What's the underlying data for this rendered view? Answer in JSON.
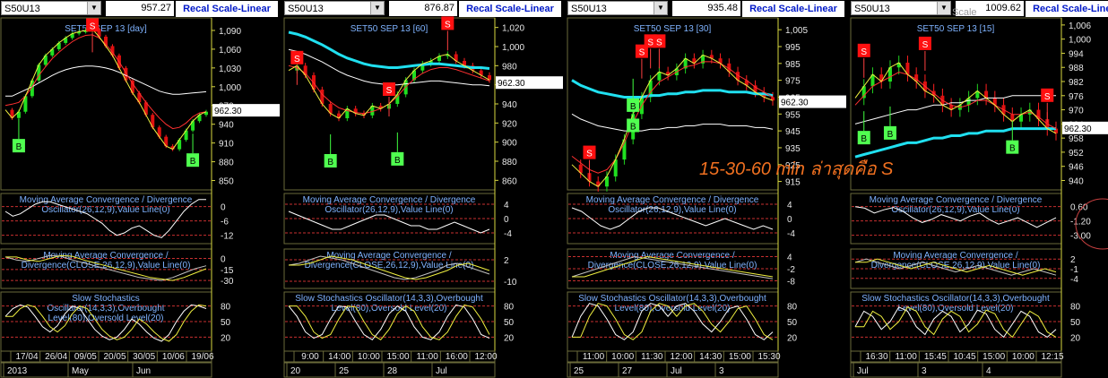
{
  "annotation": "15-30-60 min ล่าสุดคือ S",
  "scale_label": "Scale",
  "chart_data": [
    {
      "type": "line",
      "symbol": "S50U13",
      "last_price": "957.27",
      "button": "Recal Scale-Linear",
      "title": "SET50 SEP 13   [day]",
      "current": "962.30",
      "current_value": 962.3,
      "ylim": [
        835,
        1110
      ],
      "price_ticks": [
        1090,
        1060,
        1030,
        1000,
        970,
        940,
        910,
        880,
        850
      ],
      "price_tick_labels": [
        "1,090",
        "1,060",
        "1,030",
        "1,000",
        "970",
        "940",
        "910",
        "880",
        "850"
      ],
      "price": [
        963,
        950,
        960,
        985,
        1010,
        1035,
        1050,
        1060,
        1070,
        1078,
        1085,
        1088,
        1090,
        1092,
        1080,
        1065,
        1050,
        1030,
        1010,
        990,
        975,
        955,
        935,
        920,
        905,
        900,
        915,
        930,
        945,
        955,
        960
      ],
      "ma_slow": [
        985,
        985,
        990,
        995,
        1000,
        1006,
        1012,
        1018,
        1023,
        1027,
        1030,
        1032,
        1033,
        1033,
        1032,
        1030,
        1027,
        1023,
        1018,
        1013,
        1008,
        1003,
        998,
        993,
        990,
        988,
        988,
        989,
        990,
        991,
        992
      ],
      "ma_fast": [
        970,
        972,
        975,
        985,
        1000,
        1018,
        1032,
        1045,
        1055,
        1064,
        1072,
        1078,
        1082,
        1083,
        1078,
        1068,
        1055,
        1040,
        1022,
        1005,
        990,
        975,
        962,
        950,
        940,
        933,
        935,
        942,
        952,
        958,
        960
      ],
      "signals": [
        {
          "label": "B",
          "index": 2,
          "value": 905
        },
        {
          "label": "S",
          "index": 13,
          "value": 1098
        },
        {
          "label": "B",
          "index": 28,
          "value": 882
        }
      ],
      "macd1": {
        "title": "Moving Average Convergence / Divergence Oscillator(26,12,9),Value Line(0)",
        "ticks": [
          "0",
          "-6",
          "-12"
        ],
        "tick_values": [
          0,
          -6,
          -12
        ],
        "ylim": [
          -14,
          4
        ],
        "values": [
          -2,
          -4,
          -3,
          -1,
          1,
          2,
          2,
          1,
          0,
          -1,
          -2,
          -3,
          -5,
          -7,
          -10,
          -12,
          -11,
          -9,
          -8,
          -10,
          -12,
          -13,
          -10,
          -6,
          -2,
          1,
          3,
          3
        ]
      },
      "macd2": {
        "title": "Moving Average Convergence / Divergence(CLOSE,26,12,9),Value Line(0)",
        "ticks": [
          "0",
          "-15",
          "-30"
        ],
        "tick_values": [
          0,
          -15,
          -30
        ],
        "ylim": [
          -36,
          8
        ],
        "values": [
          2,
          -2,
          -4,
          0,
          4,
          3,
          -2,
          -6,
          -10,
          -14,
          -18,
          -22,
          -26,
          -28,
          -30,
          -26,
          -20,
          -14,
          -10
        ]
      },
      "stoch": {
        "title": "Slow Stochastics Oscillator(14,3,3),Overbought Level(80),Oversold Level(20)",
        "ticks": [
          "80",
          "50",
          "20"
        ],
        "tick_values": [
          80,
          50,
          20
        ],
        "values": [
          60,
          75,
          82,
          78,
          60,
          40,
          30,
          42,
          65,
          80,
          75,
          55,
          35,
          22,
          15,
          20,
          35,
          55,
          45,
          30,
          18,
          12,
          25,
          50,
          70,
          82,
          80,
          75
        ]
      },
      "time_labels": [
        "17/04",
        "26/04",
        "09/05",
        "20/05",
        "30/05",
        "10/06",
        "19/06"
      ],
      "period_labels": [
        "2013",
        "May",
        "Jun"
      ]
    },
    {
      "type": "line",
      "symbol": "S50U13",
      "last_price": "876.87",
      "button": "Recal Scale-Linear",
      "title": "SET50 SEP 13   [60]",
      "current": "962.30",
      "current_value": 962.3,
      "ylim": [
        850,
        1030
      ],
      "price_ticks": [
        1020,
        1000,
        980,
        960,
        940,
        920,
        900,
        880,
        860
      ],
      "price_tick_labels": [
        "1,020",
        "1,000",
        "980",
        "960",
        "940",
        "920",
        "900",
        "880",
        "860"
      ],
      "price": [
        975,
        980,
        970,
        955,
        940,
        930,
        925,
        935,
        930,
        928,
        938,
        935,
        940,
        950,
        965,
        975,
        982,
        985,
        990,
        992,
        985,
        980,
        975,
        970,
        965
      ],
      "ma_slow": [
        1015,
        1013,
        1010,
        1006,
        1002,
        997,
        992,
        988,
        985,
        982,
        980,
        979,
        978,
        978,
        979,
        980,
        981,
        982,
        982,
        981,
        980,
        979,
        978,
        978,
        977
      ],
      "ma_fast": [
        980,
        978,
        972,
        962,
        950,
        942,
        936,
        933,
        931,
        930,
        932,
        935,
        940,
        948,
        958,
        966,
        972,
        976,
        978,
        978,
        976,
        973,
        970,
        967,
        964
      ],
      "signals": [
        {
          "label": "S",
          "index": 1,
          "value": 988
        },
        {
          "label": "B",
          "index": 5,
          "value": 880
        },
        {
          "label": "S",
          "index": 12,
          "value": 955
        },
        {
          "label": "B",
          "index": 13,
          "value": 882
        },
        {
          "label": "S",
          "index": 19,
          "value": 1024
        }
      ],
      "macd1": {
        "title": "Moving Average Convergence / Divergence Oscillator(26,12,9),Value Line(0)",
        "ticks": [
          "4",
          "0",
          "-4"
        ],
        "tick_values": [
          4,
          0,
          -4
        ],
        "ylim": [
          -6,
          6
        ],
        "values": [
          2,
          1,
          0,
          -1,
          -2,
          -3,
          -3,
          -2,
          -1,
          0,
          1,
          1,
          0,
          -1,
          -2,
          -2,
          -3,
          -3,
          -2,
          -1,
          -2,
          -3,
          -4,
          -3
        ]
      },
      "macd2": {
        "title": "Moving Average Convergence / Divergence(CLOSE,26,12,9),Value Line(0)",
        "ticks": [
          "2",
          "-10"
        ],
        "tick_values": [
          2,
          -10
        ],
        "ylim": [
          -12,
          6
        ],
        "values": [
          -1,
          0,
          2,
          4,
          3,
          2,
          0,
          -2,
          -4,
          -6,
          -8,
          -9,
          -8,
          -6,
          -4,
          -1,
          0,
          -2,
          -4,
          -6
        ]
      },
      "stoch": {
        "title": "Slow Stochastics Oscillator(14,3,3),Overbought Level(80),Oversold Level(20)",
        "ticks": [
          "80",
          "50",
          "20"
        ],
        "tick_values": [
          80,
          50,
          20
        ],
        "values": [
          80,
          60,
          30,
          18,
          25,
          55,
          80,
          78,
          50,
          25,
          15,
          35,
          65,
          80,
          70,
          40,
          20,
          15,
          30,
          60,
          82,
          78,
          55,
          25,
          18
        ]
      },
      "time_labels": [
        "9:00",
        "14:00",
        "10:00",
        "15:00",
        "11:00",
        "16:00",
        "12:00"
      ],
      "period_labels": [
        "20",
        "25",
        "28",
        "Jul"
      ]
    },
    {
      "type": "line",
      "symbol": "S50U13",
      "last_price": "935.48",
      "button": "Recal Scale-Linear",
      "title": "SET50 SEP 13   [30]",
      "current": "962.30",
      "current_value": 962.3,
      "ylim": [
        910,
        1012
      ],
      "price_ticks": [
        1005,
        995,
        985,
        975,
        965,
        955,
        945,
        935,
        925,
        915
      ],
      "price_tick_labels": [
        "1,005",
        "995",
        "985",
        "975",
        "965",
        "955",
        "945",
        "935",
        "925",
        "915"
      ],
      "price": [
        925,
        920,
        915,
        912,
        918,
        928,
        940,
        955,
        965,
        975,
        980,
        978,
        982,
        988,
        985,
        990,
        988,
        985,
        980,
        975,
        972,
        968,
        965,
        963
      ],
      "ma_slow": [
        975,
        972,
        970,
        968,
        967,
        966,
        965,
        965,
        965,
        966,
        966,
        967,
        967,
        968,
        968,
        969,
        969,
        969,
        968,
        968,
        968,
        967,
        967,
        966
      ],
      "ma_fast": [
        930,
        926,
        922,
        920,
        922,
        928,
        938,
        950,
        960,
        968,
        974,
        977,
        980,
        983,
        984,
        986,
        986,
        985,
        982,
        978,
        975,
        971,
        968,
        965
      ],
      "signals": [
        {
          "label": "S",
          "index": 2,
          "value": 932
        },
        {
          "label": "B",
          "index": 7,
          "value": 948
        },
        {
          "label": "B",
          "index": 7,
          "value": 960
        },
        {
          "label": "S",
          "index": 8,
          "value": 992
        },
        {
          "label": "S",
          "index": 9,
          "value": 998
        },
        {
          "label": "S",
          "index": 10,
          "value": 998
        }
      ],
      "macd1": {
        "title": "Moving Average Convergence / Divergence Oscillator(26,12,9),Value Line(0)",
        "ticks": [
          "4",
          "0",
          "-4"
        ],
        "tick_values": [
          4,
          0,
          -4
        ],
        "ylim": [
          -6,
          6
        ],
        "values": [
          3,
          2,
          0,
          -2,
          -3,
          -2,
          0,
          2,
          3,
          3,
          2,
          1,
          0,
          -1,
          -2,
          -1,
          0,
          -1,
          -2,
          -3,
          -2,
          -3
        ]
      },
      "macd2": {
        "title": "Moving Average Convergence / Divergence(CLOSE,26,12,9),Value Line(0)",
        "ticks": [
          "4",
          "-2",
          "-8"
        ],
        "tick_values": [
          4,
          -2,
          -8
        ],
        "ylim": [
          -10,
          6
        ],
        "values": [
          -6,
          -4,
          -2,
          0,
          2,
          4,
          3,
          2,
          1,
          0,
          -1,
          -2,
          -3,
          -4,
          -5,
          -6,
          -7
        ]
      },
      "stoch": {
        "title": "Slow Stochastics Oscillator(14,3,3),Overbought Level(80),Oversold Level(20)",
        "ticks": [
          "80",
          "50",
          "20"
        ],
        "tick_values": [
          80,
          50,
          20
        ],
        "values": [
          20,
          60,
          85,
          80,
          55,
          25,
          15,
          30,
          70,
          85,
          80,
          60,
          80,
          85,
          70,
          45,
          30,
          50,
          75,
          80,
          55,
          25,
          15,
          30
        ]
      },
      "time_labels": [
        "11:00",
        "10:00",
        "11:30",
        "12:00",
        "14:30",
        "15:00",
        "15:30"
      ],
      "period_labels": [
        "25",
        "27",
        "Jul",
        "3"
      ]
    },
    {
      "type": "line",
      "symbol": "S50U13",
      "last_price": "1009.62",
      "button": "Recal Scale-Linear",
      "title": "SET50 SEP 13   [15]",
      "current": "962.30",
      "current_value": 962.3,
      "ylim": [
        936,
        1009
      ],
      "price_ticks": [
        1006,
        1000,
        994,
        988,
        982,
        976,
        970,
        964,
        958,
        952,
        946,
        940
      ],
      "price_tick_labels": [
        "1,006",
        "1,000",
        "994",
        "988",
        "982",
        "976",
        "970",
        "964",
        "958",
        "952",
        "946",
        "940"
      ],
      "price": [
        975,
        980,
        985,
        982,
        988,
        990,
        985,
        982,
        978,
        976,
        972,
        970,
        972,
        975,
        978,
        975,
        972,
        968,
        965,
        968,
        970,
        966,
        962,
        960
      ],
      "ma_slow": [
        950,
        951,
        952,
        953,
        954,
        955,
        956,
        956,
        957,
        958,
        958,
        959,
        959,
        960,
        960,
        961,
        961,
        961,
        962,
        962,
        962,
        962,
        962,
        962
      ],
      "ma_fast": [
        972,
        976,
        980,
        982,
        984,
        986,
        985,
        983,
        980,
        977,
        974,
        972,
        971,
        972,
        974,
        974,
        972,
        970,
        968,
        968,
        969,
        967,
        964,
        962
      ],
      "signals": [
        {
          "label": "B",
          "index": 1,
          "value": 958
        },
        {
          "label": "S",
          "index": 1,
          "value": 995
        },
        {
          "label": "B",
          "index": 4,
          "value": 960
        },
        {
          "label": "S",
          "index": 8,
          "value": 998
        },
        {
          "label": "B",
          "index": 18,
          "value": 954
        },
        {
          "label": "S",
          "index": 22,
          "value": 976
        }
      ],
      "macd1": {
        "title": "Moving Average Convergence / Divergence Oscillator(26,12,9),Value Line(0)",
        "ticks": [
          "0.60",
          "-1.20",
          "-3.00"
        ],
        "tick_values": [
          0.6,
          -1.2,
          -3.0
        ],
        "ylim": [
          -3.6,
          1.8
        ],
        "values": [
          0.6,
          0.4,
          -0.2,
          0.2,
          0.5,
          0.0,
          -0.8,
          -1.4,
          -1.0,
          -0.4,
          -0.8,
          -1.2,
          -0.6,
          -0.2,
          -1.0,
          -1.6,
          -1.2,
          -0.8,
          -1.4,
          -2.0,
          -1.4,
          -0.8
        ]
      },
      "macd2": {
        "title": "Moving Average Convergence / Divergence(CLOSE,26,12,9),Value Line(0)",
        "ticks": [
          "2",
          "-1",
          "-4"
        ],
        "tick_values": [
          2,
          -1,
          -4
        ],
        "ylim": [
          -6,
          4
        ],
        "values": [
          1,
          2,
          1,
          0,
          -1,
          0,
          1,
          0,
          -1,
          -2,
          -1,
          0,
          -1,
          -2,
          -3,
          -2,
          -1,
          -2,
          -3
        ]
      },
      "stoch": {
        "title": "Slow Stochastics Oscillator(14,3,3),Overbought Level(80),Oversold Level(20)",
        "ticks": [
          "80",
          "50",
          "20"
        ],
        "tick_values": [
          80,
          50,
          20
        ],
        "values": [
          40,
          70,
          60,
          35,
          50,
          78,
          70,
          40,
          25,
          55,
          70,
          60,
          30,
          45,
          72,
          65,
          35,
          20,
          45,
          70,
          60,
          30,
          20,
          35
        ]
      },
      "time_labels": [
        "16:30",
        "11:00",
        "15:45",
        "10:45",
        "15:00",
        "10:00",
        "12:15"
      ],
      "period_labels": [
        "Jul",
        "3",
        "4"
      ]
    }
  ]
}
